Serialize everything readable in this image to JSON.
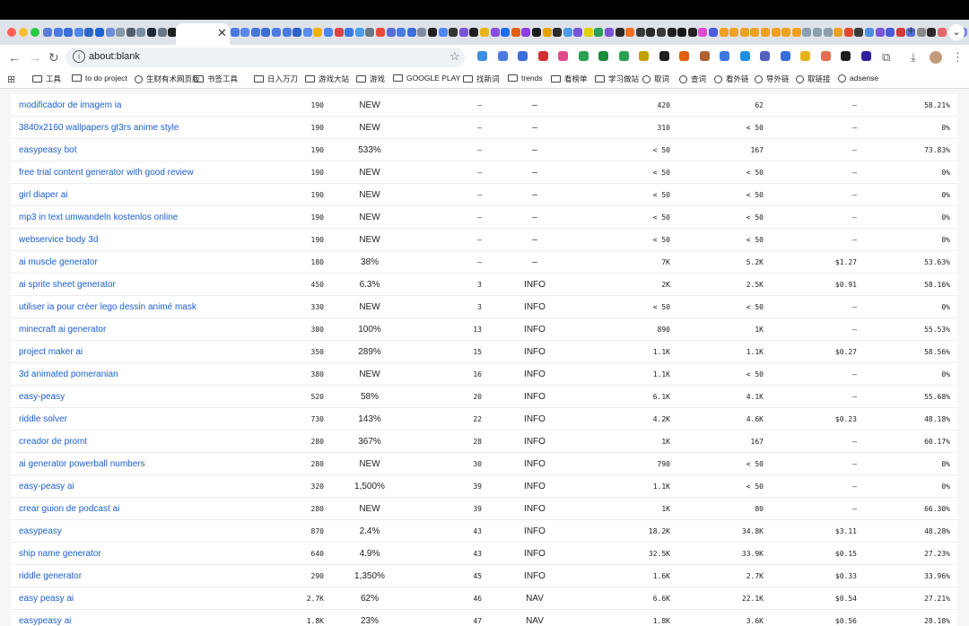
{
  "browser": {
    "url": "about:blank",
    "tab_close_glyph": "✕",
    "new_tab_glyph": "+",
    "tab_search_glyph": "⌄",
    "traffic_colors": [
      "#ff5f57",
      "#febc2e",
      "#28c840"
    ],
    "tab_icon_colors": [
      "#5b7fd6",
      "#4a7be0",
      "#3b6fd9",
      "#4f86f0",
      "#2f65c8",
      "#1c63d6",
      "#6b8fd8",
      "#8899aa",
      "#555f70",
      "#7a8fa0",
      "#1f2a36",
      "#6a7787",
      "#202020",
      "#3a6fe0",
      "#1e88e5",
      "#3b3b3b",
      "#5470e0",
      "#3f6ad8",
      "#4a79dd",
      "#5a88e6",
      "#4877d8",
      "#3d6ed4",
      "#4c7ce0",
      "#4a7be0",
      "#2d62c9",
      "#5b8ef0",
      "#eeb400",
      "#4f86f0",
      "#d44",
      "#3c78e0",
      "#4c9be8",
      "#6c7a89",
      "#e94a3a",
      "#5a6bd8",
      "#4a7be0",
      "#3c6fd9",
      "#7f8d9c",
      "#202020",
      "#4f86f0",
      "#353535",
      "#7a55d8",
      "#1f1f1f",
      "#e8b31a",
      "#8a4fd8",
      "#1f6feb",
      "#e06010",
      "#8a3de0",
      "#1b1b1b",
      "#e5a100",
      "#2a2a2a",
      "#4c9be8",
      "#7a55d8",
      "#e0d000",
      "#2aa150",
      "#7a55d8",
      "#2a2a2a",
      "#f07020",
      "#3a3a3a",
      "#2a2a2a",
      "#3a3a3a",
      "#1f1f1f",
      "#171717",
      "#232323",
      "#e04ad0",
      "#4a5ad8",
      "#f0a020",
      "#f0a020",
      "#f0a020",
      "#f0a020",
      "#f0a020",
      "#f0a020",
      "#f0a020",
      "#f0a020",
      "#8aa0b0",
      "#8aa0b0",
      "#8aa0b0",
      "#f0a020",
      "#e04a2a",
      "#3a3a3a",
      "#4f8fe0",
      "#7a55d8",
      "#4a5ad8",
      "#d03a3a",
      "#5a6bd8",
      "#8a8a8a",
      "#2a2a2a",
      "#e06a6a",
      "#e04a4a",
      "#7a88e0",
      "#3aa060",
      "#b040c0"
    ],
    "extension_colors": [
      "#3c8ee0",
      "#4a7be0",
      "#3b6fd9",
      "#d03030",
      "#e04a8a",
      "#2aa150",
      "#1b8a3a",
      "#2aa150",
      "#c0a000",
      "#1f1f1f",
      "#e06010",
      "#b06030",
      "#3c78e0",
      "#1f8ee0",
      "#5060c0",
      "#3a6fd9",
      "#e8b31a",
      "#e07050",
      "#1f1f1f",
      "#3020a0"
    ],
    "bookmarks": [
      {
        "icon": "folder-icon",
        "label": "工具"
      },
      {
        "icon": "folder-icon",
        "label": "to do project"
      },
      {
        "icon": "globe-icon",
        "label": "生财有术网页版"
      },
      {
        "icon": "folder-icon",
        "label": "书签工具"
      },
      {
        "icon": "folder-icon",
        "label": "日入万刀"
      },
      {
        "icon": "folder-icon",
        "label": "游戏大站"
      },
      {
        "icon": "folder-icon",
        "label": "游戏"
      },
      {
        "icon": "folder-icon",
        "label": "GOOGLE PLAY"
      },
      {
        "icon": "folder-icon",
        "label": "找新词"
      },
      {
        "icon": "folder-icon",
        "label": "trends"
      },
      {
        "icon": "folder-icon",
        "label": "看榜单"
      },
      {
        "icon": "folder-icon",
        "label": "学习做站"
      },
      {
        "icon": "globe-icon",
        "label": "取词"
      },
      {
        "icon": "globe-icon",
        "label": "查词"
      },
      {
        "icon": "globe-icon",
        "label": "看外链"
      },
      {
        "icon": "globe-icon",
        "label": "导外链"
      },
      {
        "icon": "globe-icon",
        "label": "取链接"
      },
      {
        "icon": "globe-icon",
        "label": "adsense"
      }
    ]
  },
  "table": {
    "rows": [
      {
        "keyword": "modificador de imagem ia",
        "volume": "190",
        "trend": "NEW",
        "kd": "–",
        "intent": "–",
        "v2": "420",
        "v3": "62",
        "cpc": "–",
        "pct": "58.21%"
      },
      {
        "keyword": "3840x2160 wallpapers gt3rs anime style",
        "volume": "190",
        "trend": "NEW",
        "kd": "–",
        "intent": "–",
        "v2": "310",
        "v3": "< 50",
        "cpc": "–",
        "pct": "0%"
      },
      {
        "keyword": "easypeasy bot",
        "volume": "190",
        "trend": "533%",
        "kd": "–",
        "intent": "–",
        "v2": "< 50",
        "v3": "167",
        "cpc": "–",
        "pct": "73.83%"
      },
      {
        "keyword": "free trial content generator with good review",
        "volume": "190",
        "trend": "NEW",
        "kd": "–",
        "intent": "–",
        "v2": "< 50",
        "v3": "< 50",
        "cpc": "–",
        "pct": "0%"
      },
      {
        "keyword": "girl diaper ai",
        "volume": "190",
        "trend": "NEW",
        "kd": "–",
        "intent": "–",
        "v2": "< 50",
        "v3": "< 50",
        "cpc": "–",
        "pct": "0%"
      },
      {
        "keyword": "mp3 in text umwandeln kostenlos online",
        "volume": "190",
        "trend": "NEW",
        "kd": "–",
        "intent": "–",
        "v2": "< 50",
        "v3": "< 50",
        "cpc": "–",
        "pct": "0%"
      },
      {
        "keyword": "webservice body 3d",
        "volume": "190",
        "trend": "NEW",
        "kd": "–",
        "intent": "–",
        "v2": "< 50",
        "v3": "< 50",
        "cpc": "–",
        "pct": "0%"
      },
      {
        "keyword": "ai muscle generator",
        "volume": "180",
        "trend": "38%",
        "kd": "–",
        "intent": "–",
        "v2": "7K",
        "v3": "5.2K",
        "cpc": "$1.27",
        "pct": "53.63%"
      },
      {
        "keyword": "ai sprite sheet generator",
        "volume": "450",
        "trend": "6.3%",
        "kd": "3",
        "intent": "INFO",
        "v2": "2K",
        "v3": "2.5K",
        "cpc": "$0.91",
        "pct": "58.16%"
      },
      {
        "keyword": "utiliser ia pour créer lego dessin animé mask",
        "volume": "330",
        "trend": "NEW",
        "kd": "3",
        "intent": "INFO",
        "v2": "< 50",
        "v3": "< 50",
        "cpc": "–",
        "pct": "0%"
      },
      {
        "keyword": "minecraft ai generator",
        "volume": "380",
        "trend": "100%",
        "kd": "13",
        "intent": "INFO",
        "v2": "890",
        "v3": "1K",
        "cpc": "–",
        "pct": "55.53%"
      },
      {
        "keyword": "project maker ai",
        "volume": "350",
        "trend": "289%",
        "kd": "15",
        "intent": "INFO",
        "v2": "1.1K",
        "v3": "1.1K",
        "cpc": "$0.27",
        "pct": "58.56%"
      },
      {
        "keyword": "3d animated pomeranian",
        "volume": "380",
        "trend": "NEW",
        "kd": "16",
        "intent": "INFO",
        "v2": "1.1K",
        "v3": "< 50",
        "cpc": "–",
        "pct": "0%"
      },
      {
        "keyword": "easy-peasy",
        "volume": "520",
        "trend": "58%",
        "kd": "20",
        "intent": "INFO",
        "v2": "6.1K",
        "v3": "4.1K",
        "cpc": "–",
        "pct": "55.68%"
      },
      {
        "keyword": "riddle solver",
        "volume": "730",
        "trend": "143%",
        "kd": "22",
        "intent": "INFO",
        "v2": "4.2K",
        "v3": "4.6K",
        "cpc": "$0.23",
        "pct": "48.18%"
      },
      {
        "keyword": "creador de promt",
        "volume": "280",
        "trend": "367%",
        "kd": "28",
        "intent": "INFO",
        "v2": "1K",
        "v3": "167",
        "cpc": "–",
        "pct": "60.17%"
      },
      {
        "keyword": "ai generator powerball numbers",
        "volume": "280",
        "trend": "NEW",
        "kd": "30",
        "intent": "INFO",
        "v2": "790",
        "v3": "< 50",
        "cpc": "–",
        "pct": "0%"
      },
      {
        "keyword": "easy-peasy ai",
        "volume": "320",
        "trend": "1,500%",
        "kd": "39",
        "intent": "INFO",
        "v2": "1.1K",
        "v3": "< 50",
        "cpc": "–",
        "pct": "0%"
      },
      {
        "keyword": "crear guion de podcast ai",
        "volume": "280",
        "trend": "NEW",
        "kd": "39",
        "intent": "INFO",
        "v2": "1K",
        "v3": "80",
        "cpc": "–",
        "pct": "66.30%"
      },
      {
        "keyword": "easypeasy",
        "volume": "870",
        "trend": "2.4%",
        "kd": "43",
        "intent": "INFO",
        "v2": "18.2K",
        "v3": "34.8K",
        "cpc": "$3.11",
        "pct": "48.28%"
      },
      {
        "keyword": "ship name generator",
        "volume": "640",
        "trend": "4.9%",
        "kd": "43",
        "intent": "INFO",
        "v2": "32.5K",
        "v3": "33.9K",
        "cpc": "$0.15",
        "pct": "27.23%"
      },
      {
        "keyword": "riddle generator",
        "volume": "290",
        "trend": "1,350%",
        "kd": "45",
        "intent": "INFO",
        "v2": "1.6K",
        "v3": "2.7K",
        "cpc": "$0.33",
        "pct": "33.96%"
      },
      {
        "keyword": "easy peasy ai",
        "volume": "2.7K",
        "trend": "62%",
        "kd": "46",
        "intent": "NAV",
        "v2": "6.6K",
        "v3": "22.1K",
        "cpc": "$0.54",
        "pct": "27.21%"
      },
      {
        "keyword": "easypeasy ai",
        "volume": "1.8K",
        "trend": "23%",
        "kd": "47",
        "intent": "NAV",
        "v2": "1.8K",
        "v3": "3.6K",
        "cpc": "$0.56",
        "pct": "28.18%"
      }
    ]
  }
}
